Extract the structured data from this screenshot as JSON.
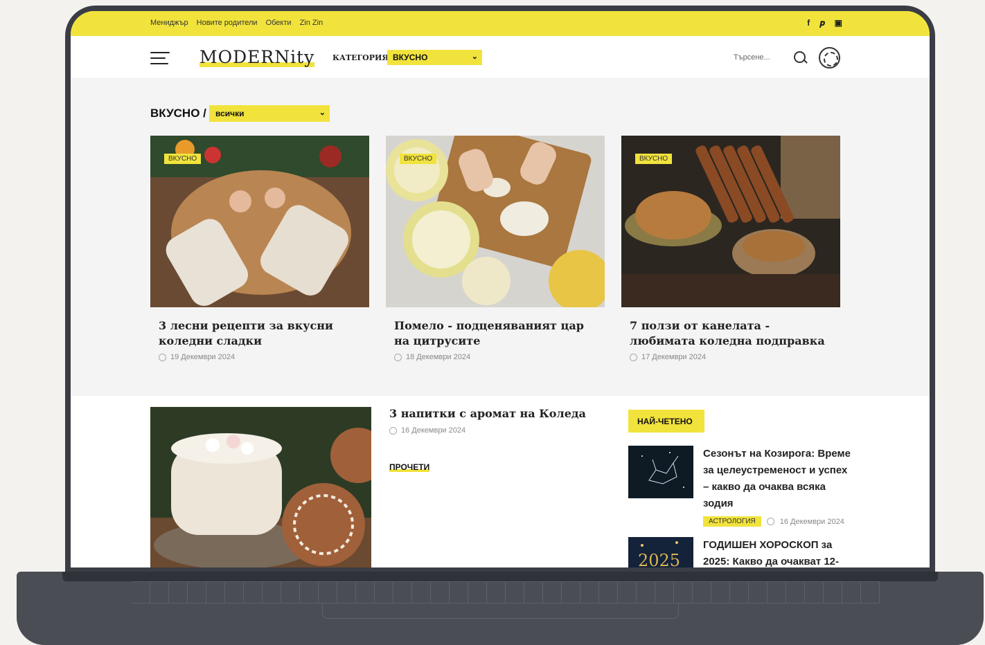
{
  "topbar": {
    "links": [
      "Мениджър",
      "Новите родители",
      "Обекти",
      "Zin Zin"
    ],
    "social": [
      "f",
      "𝒑",
      "▣"
    ]
  },
  "header": {
    "logo": "MODERNity",
    "category_label": "КАТЕГОРИЯ:",
    "category_selected": "ВКУСНО",
    "search_placeholder": "Търсене..."
  },
  "section": {
    "breadcrumb": "ВКУСНО /",
    "subcategory_selected": "всички"
  },
  "cards": [
    {
      "badge": "ВКУСНО",
      "title": "3 лесни рецепти за вкусни коледни сладки",
      "date": "19 Декември 2024"
    },
    {
      "badge": "ВКУСНО",
      "title": "Помело - подценяваният цар на цитрусите",
      "date": "18 Декември 2024"
    },
    {
      "badge": "ВКУСНО",
      "title": "7 ползи от канелата - любимата коледна подправка",
      "date": "17 Декември 2024"
    }
  ],
  "featured": {
    "title": "3 напитки с аромат на Коледа",
    "date": "16 Декември 2024",
    "read_more": "ПРОЧЕТИ"
  },
  "most_read": {
    "heading": "НАЙ-ЧЕТЕНО",
    "items": [
      {
        "title": "Сезонът на Козирога: Време за целеустременост и успех – какво да очаква всяка зодия",
        "tag": "АСТРОЛОГИЯ",
        "date": "16 Декември 2024"
      },
      {
        "title": "ГОДИШЕН ХОРОСКОП за 2025: Какво да очакват 12-"
      }
    ]
  },
  "colors": {
    "accent": "#f1e33c",
    "laptop": "#3a3d44",
    "grey_bg": "#f4f4f4"
  }
}
